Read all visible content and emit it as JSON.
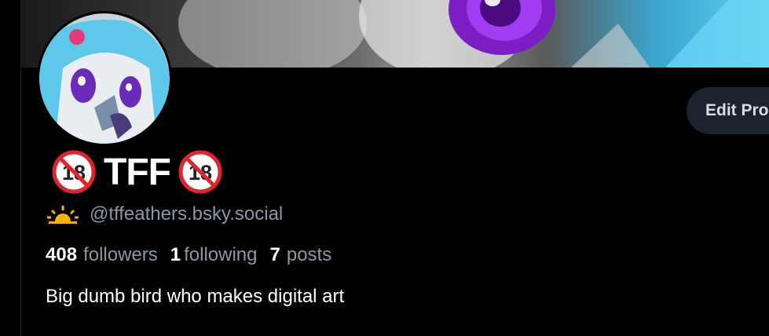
{
  "profile": {
    "display_name": "TFF",
    "handle": "@tffeathers.bsky.social",
    "edit_button": "Edit Pro",
    "bio": "Big dumb bird who makes digital art",
    "badge_left": "no-under-18-icon",
    "badge_right": "no-under-18-icon",
    "badge_text": "18",
    "handle_icon": "sunrise-icon"
  },
  "stats": {
    "followers": {
      "count": "408",
      "label": "followers"
    },
    "following": {
      "count": "1",
      "label": "following"
    },
    "posts": {
      "count": "7",
      "label": "posts"
    }
  },
  "colors": {
    "background": "#000000",
    "secondary_text": "#8b98a5",
    "button_bg": "#1b232c",
    "badge_red": "#e0242c",
    "sun_yellow": "#f5b400"
  }
}
